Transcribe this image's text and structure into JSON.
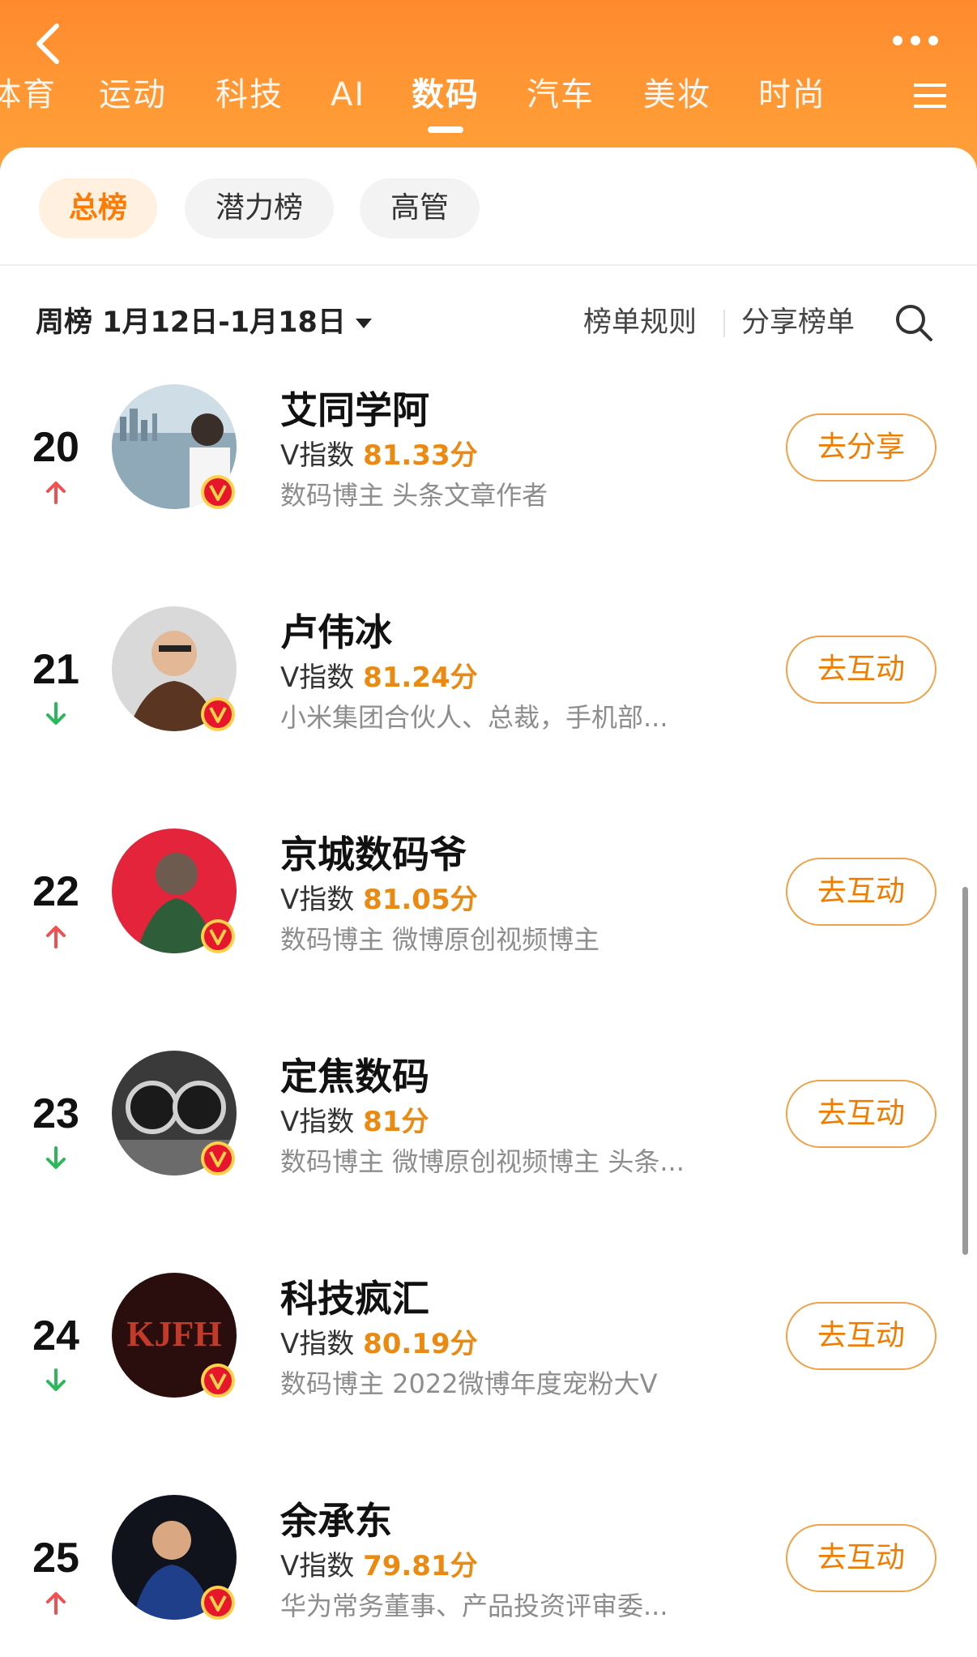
{
  "nav": {
    "tabs": [
      {
        "label": "体育",
        "active": false
      },
      {
        "label": "运动",
        "active": false
      },
      {
        "label": "科技",
        "active": false
      },
      {
        "label": "AI",
        "active": false
      },
      {
        "label": "数码",
        "active": true
      },
      {
        "label": "汽车",
        "active": false
      },
      {
        "label": "美妆",
        "active": false
      },
      {
        "label": "时尚",
        "active": false
      }
    ],
    "back_icon": "chevron-left-icon",
    "more_icon": "more-dots-icon",
    "menu_icon": "menu-icon"
  },
  "subtabs": [
    {
      "label": "总榜",
      "active": true
    },
    {
      "label": "潜力榜",
      "active": false
    },
    {
      "label": "高管",
      "active": false
    }
  ],
  "filter": {
    "period": "周榜 1月12日-1月18日",
    "rules_label": "榜单规则",
    "share_label": "分享榜单",
    "search_icon": "search-icon"
  },
  "score_label": "V指数",
  "colors": {
    "accent": "#ff8a2e",
    "score": "#ea8a12",
    "up": "#f05050",
    "down": "#2cb85a",
    "badge": "#e6162d"
  },
  "rankings": [
    {
      "rank": "20",
      "trend": "up",
      "name": "艾同学阿",
      "score": "81.33分",
      "desc": "数码博主 头条文章作者",
      "action": "去分享"
    },
    {
      "rank": "21",
      "trend": "down",
      "name": "卢伟冰",
      "score": "81.24分",
      "desc": "小米集团合伙人、总裁，手机部...",
      "action": "去互动"
    },
    {
      "rank": "22",
      "trend": "up",
      "name": "京城数码爷",
      "score": "81.05分",
      "desc": "数码博主 微博原创视频博主",
      "action": "去互动"
    },
    {
      "rank": "23",
      "trend": "down",
      "name": "定焦数码",
      "score": "81分",
      "desc": "数码博主 微博原创视频博主 头条...",
      "action": "去互动"
    },
    {
      "rank": "24",
      "trend": "down",
      "name": "科技疯汇",
      "score": "80.19分",
      "desc": "数码博主 2022微博年度宠粉大V",
      "action": "去互动"
    },
    {
      "rank": "25",
      "trend": "up",
      "name": "余承东",
      "score": "79.81分",
      "desc": "华为常务董事、产品投资评审委...",
      "action": "去互动"
    }
  ],
  "avatar_texts": {
    "kjfh": "KJFH"
  }
}
